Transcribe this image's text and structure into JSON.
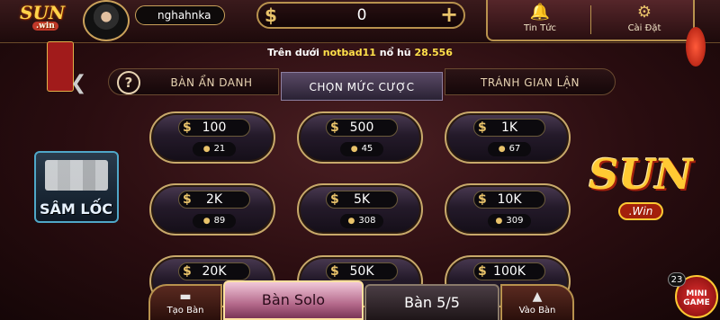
{
  "header": {
    "username": "nghahnka",
    "coin_icon": "$",
    "balance": "0",
    "add_icon": "+",
    "news_label": "Tin Tức",
    "settings_label": "Cài Đặt"
  },
  "notice": {
    "prefix": "Trên dưới ",
    "player": "notbad11",
    "middle": " nổ hũ ",
    "amount": "28.556"
  },
  "tabs": {
    "anonymous": "BÀN ẨN DANH",
    "choose_bet": "CHỌN MỨC CƯỢC",
    "anti_cheat": "TRÁNH GIAN LẬN"
  },
  "bets": [
    {
      "amount": "100",
      "players": "21"
    },
    {
      "amount": "500",
      "players": "45"
    },
    {
      "amount": "1K",
      "players": "67"
    },
    {
      "amount": "2K",
      "players": "89"
    },
    {
      "amount": "5K",
      "players": "308"
    },
    {
      "amount": "10K",
      "players": "309"
    },
    {
      "amount": "20K",
      "players": ""
    },
    {
      "amount": "50K",
      "players": ""
    },
    {
      "amount": "100K",
      "players": ""
    }
  ],
  "promos": {
    "samloc": "SÂM LỐC",
    "logo_main": "SUN",
    "logo_sub": ".Win",
    "mini_game": "MINI GAME",
    "mini_badge": "23"
  },
  "bottom": {
    "create_label": "Tạo Bàn",
    "solo_label": "Bàn Solo",
    "five_label": "Bàn 5/5",
    "join_label": "Vào Bàn"
  },
  "colors": {
    "gold": "#e9c36a",
    "highlight": "#ffe04a"
  }
}
